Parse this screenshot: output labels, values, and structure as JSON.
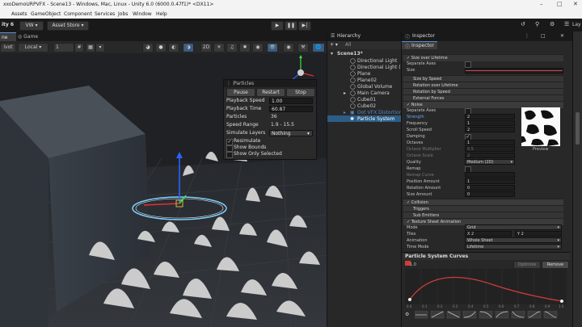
{
  "window": {
    "title": "xxoDemoURPVFX - Scene13 - Windows, Mac, Linux - Unity 6.0 (6000.0.47f1)* <DX11>",
    "minimize_icon": "minimize-icon",
    "maximize_icon": "maximize-icon",
    "close_icon": "close-icon"
  },
  "menu": [
    "Assets",
    "GameObject",
    "Component",
    "Services",
    "Jobs",
    "Window",
    "Help"
  ],
  "toolbar": {
    "brand": "ity 6",
    "account": "VW",
    "asset_store": "Asset Store",
    "right_tab": "Lay"
  },
  "view_tabs": [
    "ne",
    "Game"
  ],
  "scene_toolbar": {
    "pivot": "ivot",
    "space": "Local",
    "snap_value": "1"
  },
  "particles_panel": {
    "title": "Particles",
    "buttons": [
      "Pause",
      "Restart",
      "Stop"
    ],
    "rows": [
      {
        "label": "Playback Speed",
        "value": "1.00"
      },
      {
        "label": "Playback Time",
        "value": "60.87"
      },
      {
        "label": "Particles",
        "value": "36"
      },
      {
        "label": "Speed Range",
        "value": "1.9 - 15.5"
      },
      {
        "label": "Simulate Layers",
        "value": "Nothing"
      }
    ],
    "checks": [
      {
        "label": "Resimulate",
        "checked": true
      },
      {
        "label": "Show Bounds",
        "checked": false
      },
      {
        "label": "Show Only Selected",
        "checked": false
      }
    ]
  },
  "hierarchy": {
    "title": "Hierarchy",
    "search_prefix": "All",
    "scene": "Scene13*",
    "items": [
      "Directional Light",
      "Directional Light (1)",
      "Plane",
      "Plane02",
      "Global Volume",
      "Main Camera",
      "Cube01",
      "Cube02",
      "Dot VFX Distortion",
      "Particle System"
    ]
  },
  "inspector": {
    "title": "Inspector",
    "object": "Inspector",
    "size_over_lifetime": "Size over Lifetime",
    "separate_axes_1": "Separate Axes",
    "size_label": "Size",
    "modules": [
      "Size by Speed",
      "Rotation over Lifetime",
      "Rotation by Speed",
      "External Forces",
      "Noise"
    ],
    "noise_rows": [
      {
        "label": "Separate Axes",
        "value": ""
      },
      {
        "label": "Strength",
        "value": "2"
      },
      {
        "label": "Frequency",
        "value": "1"
      },
      {
        "label": "Scroll Speed",
        "value": "2"
      },
      {
        "label": "Damping",
        "value": "✓"
      },
      {
        "label": "Octaves",
        "value": "1"
      },
      {
        "label": "Octave Multiplier",
        "value": "0.5"
      },
      {
        "label": "Octave Scale",
        "value": "2"
      },
      {
        "label": "Quality",
        "value": "Medium (2D)"
      },
      {
        "label": "Remap",
        "value": ""
      },
      {
        "label": "Remap Curve",
        "value": ""
      },
      {
        "label": "Position Amount",
        "value": "1"
      },
      {
        "label": "Rotation Amount",
        "value": "0"
      },
      {
        "label": "Size Amount",
        "value": "0"
      }
    ],
    "preview_label": "Preview",
    "modules_after": [
      "Collision",
      "Triggers",
      "Sub Emitters",
      "Texture Sheet Animation"
    ],
    "tsa_rows": [
      {
        "label": "Mode",
        "value": "Grid"
      },
      {
        "label": "Tiles",
        "value": "X 2",
        "value2": "Y 2"
      },
      {
        "label": "Animation",
        "value": "Whole Sheet"
      },
      {
        "label": "Time Mode",
        "value": "Lifetime"
      }
    ],
    "curves_title": "Particle System Curves",
    "optimize": "Optimize",
    "remove": "Remove",
    "curve_max": "1.0",
    "curve_ticks": [
      "0.0",
      "0.1",
      "0.2",
      "0.3",
      "0.4",
      "0.5",
      "0.6",
      "0.7",
      "0.8",
      "0.9",
      "1.0"
    ]
  }
}
